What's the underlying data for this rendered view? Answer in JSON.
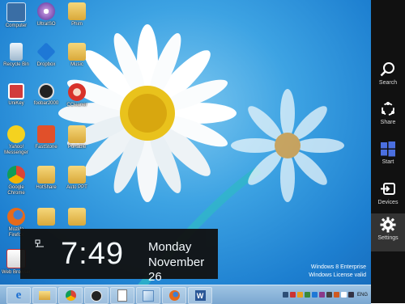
{
  "desktop": {
    "icons": [
      {
        "label": "Computer",
        "icon": "computer-icon"
      },
      {
        "label": "UltraISO",
        "icon": "ultraiso-icon"
      },
      {
        "label": "Phim",
        "icon": "folder-icon"
      },
      {
        "label": "Recycle Bin",
        "icon": "recycle-bin-icon"
      },
      {
        "label": "Dropbox",
        "icon": "dropbox-icon"
      },
      {
        "label": "Music",
        "icon": "folder-icon"
      },
      {
        "label": "UniKey",
        "icon": "unikey-icon"
      },
      {
        "label": "foobar2000",
        "icon": "foobar-icon"
      },
      {
        "label": "CCleaner",
        "icon": "ccleaner-icon"
      },
      {
        "label": "Yahoo! Messenger",
        "icon": "yahoo-messenger-icon"
      },
      {
        "label": "FastStone",
        "icon": "faststone-icon"
      },
      {
        "label": "Portable",
        "icon": "folder-icon"
      },
      {
        "label": "Google Chrome",
        "icon": "chrome-icon"
      },
      {
        "label": "HotShare",
        "icon": "folder-icon"
      },
      {
        "label": "Auto PPT",
        "icon": "folder-icon"
      },
      {
        "label": "Mozilla Firefox",
        "icon": "firefox-icon"
      },
      {
        "label": "",
        "icon": "folder-icon"
      },
      {
        "label": "",
        "icon": "folder-icon"
      },
      {
        "label": "Web Browser",
        "icon": "app-icon"
      }
    ]
  },
  "clock": {
    "time": "7:49",
    "day": "Monday",
    "date": "November 26"
  },
  "watermark": {
    "line1": "Windows 8 Enterprise",
    "line2": "Windows License valid"
  },
  "charms": [
    {
      "label": "Search",
      "icon": "search-icon"
    },
    {
      "label": "Share",
      "icon": "share-icon"
    },
    {
      "label": "Start",
      "icon": "windows-logo-icon"
    },
    {
      "label": "Devices",
      "icon": "devices-icon"
    },
    {
      "label": "Settings",
      "icon": "gear-icon"
    }
  ],
  "taskbar": {
    "apps": [
      "internet-explorer-icon",
      "file-explorer-icon",
      "chrome-icon",
      "foobar-icon",
      "document-icon",
      "glass-icon",
      "firefox-icon",
      "word-icon"
    ],
    "tray_language": "ENG"
  },
  "colors": {
    "charm_bar": "#111111",
    "taskbar": "#8db7dc",
    "wallpaper": "#2b8fd9"
  }
}
